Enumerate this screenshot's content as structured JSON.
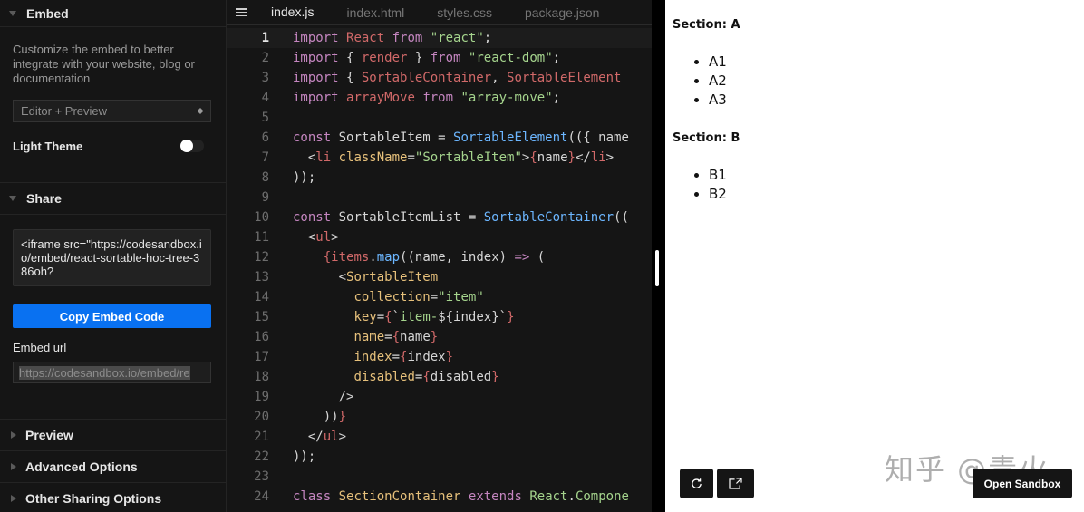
{
  "sidebar": {
    "embed": {
      "title": "Embed",
      "description": "Customize the embed to better integrate with your website, blog or documentation",
      "view_select": "Editor + Preview",
      "light_theme_label": "Light Theme",
      "light_theme_enabled": false
    },
    "share": {
      "title": "Share",
      "embed_code": "<iframe src=\"https://codesandbox.io/embed/react-sortable-hoc-tree-386oh?",
      "copy_button": "Copy Embed Code",
      "embed_url_label": "Embed url",
      "embed_url_value": "https://codesandbox.io/embed/re"
    },
    "collapsed_sections": [
      {
        "title": "Preview"
      },
      {
        "title": "Advanced Options"
      },
      {
        "title": "Other Sharing Options"
      }
    ]
  },
  "editor": {
    "menu_icon": "hamburger-menu-icon",
    "tabs": [
      {
        "label": "index.js",
        "active": true
      },
      {
        "label": "index.html",
        "active": false
      },
      {
        "label": "styles.css",
        "active": false
      },
      {
        "label": "package.json",
        "active": false
      }
    ],
    "current_line": 1,
    "lines": [
      {
        "n": "1"
      },
      {
        "n": "2"
      },
      {
        "n": "3"
      },
      {
        "n": "4"
      },
      {
        "n": "5"
      },
      {
        "n": "6"
      },
      {
        "n": "7"
      },
      {
        "n": "8"
      },
      {
        "n": "9"
      },
      {
        "n": "10"
      },
      {
        "n": "11"
      },
      {
        "n": "12"
      },
      {
        "n": "13"
      },
      {
        "n": "14"
      },
      {
        "n": "15"
      },
      {
        "n": "16"
      },
      {
        "n": "17"
      },
      {
        "n": "18"
      },
      {
        "n": "19"
      },
      {
        "n": "20"
      },
      {
        "n": "21"
      },
      {
        "n": "22"
      },
      {
        "n": "23"
      },
      {
        "n": "24"
      }
    ],
    "code": [
      [
        [
          "kw",
          "import"
        ],
        [
          "pun",
          " "
        ],
        [
          "var",
          "React"
        ],
        [
          "pun",
          " "
        ],
        [
          "kw",
          "from"
        ],
        [
          "pun",
          " "
        ],
        [
          "str",
          "\"react\""
        ],
        [
          "pun",
          ";"
        ]
      ],
      [
        [
          "kw",
          "import"
        ],
        [
          "pun",
          " { "
        ],
        [
          "var",
          "render"
        ],
        [
          "pun",
          " } "
        ],
        [
          "kw",
          "from"
        ],
        [
          "pun",
          " "
        ],
        [
          "str",
          "\"react-dom\""
        ],
        [
          "pun",
          ";"
        ]
      ],
      [
        [
          "kw",
          "import"
        ],
        [
          "pun",
          " { "
        ],
        [
          "var",
          "SortableContainer"
        ],
        [
          "pun",
          ", "
        ],
        [
          "var",
          "SortableElement"
        ]
      ],
      [
        [
          "kw",
          "import"
        ],
        [
          "pun",
          " "
        ],
        [
          "var",
          "arrayMove"
        ],
        [
          "pun",
          " "
        ],
        [
          "kw",
          "from"
        ],
        [
          "pun",
          " "
        ],
        [
          "str",
          "\"array-move\""
        ],
        [
          "pun",
          ";"
        ]
      ],
      [],
      [
        [
          "kw",
          "const"
        ],
        [
          "pun",
          " SortableItem = "
        ],
        [
          "fn",
          "SortableElement"
        ],
        [
          "pun",
          "(({ name"
        ]
      ],
      [
        [
          "pun",
          "  <"
        ],
        [
          "tag",
          "li"
        ],
        [
          "pun",
          " "
        ],
        [
          "attr",
          "className"
        ],
        [
          "pun",
          "="
        ],
        [
          "str",
          "\"SortableItem\""
        ],
        [
          "pun",
          ">"
        ],
        [
          "brace",
          "{"
        ],
        [
          "pun",
          "name"
        ],
        [
          "brace",
          "}"
        ],
        [
          "pun",
          "</"
        ],
        [
          "tag",
          "li"
        ],
        [
          "pun",
          ">"
        ]
      ],
      [
        [
          "pun",
          "));"
        ]
      ],
      [],
      [
        [
          "kw",
          "const"
        ],
        [
          "pun",
          " SortableItemList = "
        ],
        [
          "fn",
          "SortableContainer"
        ],
        [
          "pun",
          "(("
        ]
      ],
      [
        [
          "pun",
          "  <"
        ],
        [
          "tag",
          "ul"
        ],
        [
          "pun",
          ">"
        ]
      ],
      [
        [
          "pun",
          "    "
        ],
        [
          "brace",
          "{"
        ],
        [
          "var",
          "items"
        ],
        [
          "pun",
          "."
        ],
        [
          "fn",
          "map"
        ],
        [
          "pun",
          "((name, index) "
        ],
        [
          "kw",
          "=>"
        ],
        [
          "pun",
          " ("
        ]
      ],
      [
        [
          "pun",
          "      <"
        ],
        [
          "cls",
          "SortableItem"
        ]
      ],
      [
        [
          "pun",
          "        "
        ],
        [
          "attr",
          "collection"
        ],
        [
          "pun",
          "="
        ],
        [
          "str",
          "\"item\""
        ]
      ],
      [
        [
          "pun",
          "        "
        ],
        [
          "attr",
          "key"
        ],
        [
          "pun",
          "="
        ],
        [
          "brace",
          "{"
        ],
        [
          "pun",
          "`"
        ],
        [
          "str",
          "item-"
        ],
        [
          "pun",
          "${index}`"
        ],
        [
          "brace",
          "}"
        ]
      ],
      [
        [
          "pun",
          "        "
        ],
        [
          "attr",
          "name"
        ],
        [
          "pun",
          "="
        ],
        [
          "brace",
          "{"
        ],
        [
          "pun",
          "name"
        ],
        [
          "brace",
          "}"
        ]
      ],
      [
        [
          "pun",
          "        "
        ],
        [
          "attr",
          "index"
        ],
        [
          "pun",
          "="
        ],
        [
          "brace",
          "{"
        ],
        [
          "pun",
          "index"
        ],
        [
          "brace",
          "}"
        ]
      ],
      [
        [
          "pun",
          "        "
        ],
        [
          "attr",
          "disabled"
        ],
        [
          "pun",
          "="
        ],
        [
          "brace",
          "{"
        ],
        [
          "pun",
          "disabled"
        ],
        [
          "brace",
          "}"
        ]
      ],
      [
        [
          "pun",
          "      />"
        ]
      ],
      [
        [
          "pun",
          "    ))"
        ],
        [
          "brace",
          "}"
        ]
      ],
      [
        [
          "pun",
          "  </"
        ],
        [
          "tag",
          "ul"
        ],
        [
          "pun",
          ">"
        ]
      ],
      [
        [
          "pun",
          "));"
        ]
      ],
      [],
      [
        [
          "kw",
          "class"
        ],
        [
          "pun",
          " "
        ],
        [
          "cls",
          "SectionContainer"
        ],
        [
          "pun",
          " "
        ],
        [
          "kw",
          "extends"
        ],
        [
          "pun",
          " "
        ],
        [
          "str",
          "React"
        ],
        [
          "pun",
          "."
        ],
        [
          "str",
          "Compone"
        ]
      ]
    ]
  },
  "preview": {
    "sections": [
      {
        "title": "Section: A",
        "items": [
          "A1",
          "A2",
          "A3"
        ]
      },
      {
        "title": "Section: B",
        "items": [
          "B1",
          "B2"
        ]
      }
    ],
    "refresh_icon": "refresh-icon",
    "open_new_window_icon": "external-link-icon",
    "open_sandbox_button": "Open Sandbox",
    "watermark": "知乎 @青火"
  },
  "colors": {
    "accent_button": "#0971f1",
    "sidebar_bg": "#151515",
    "editor_bg": "#151515"
  }
}
